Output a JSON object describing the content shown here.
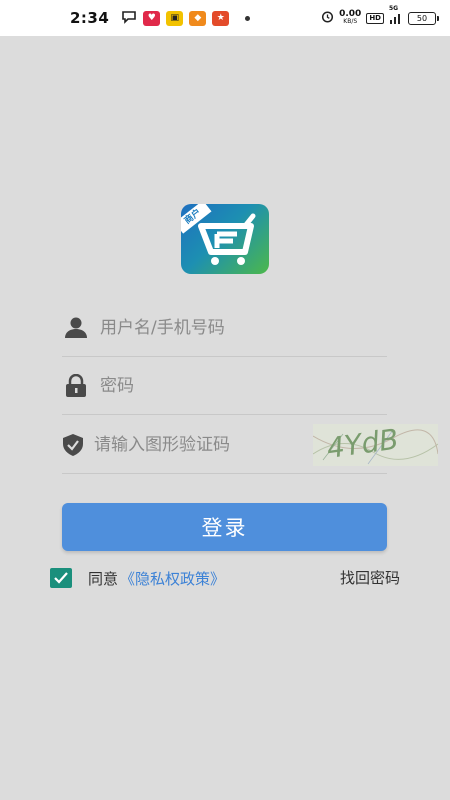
{
  "status_bar": {
    "time": "2:34",
    "net_speed_value": "0.00",
    "net_speed_unit": "KB/S",
    "hd_label": "HD",
    "signal_label": "5G",
    "battery_level": "50"
  },
  "logo": {
    "tag_text": "商户"
  },
  "form": {
    "username_placeholder": "用户名/手机号码",
    "password_placeholder": "密码",
    "captcha_placeholder": "请输入图形验证码",
    "captcha_text": "4YdB"
  },
  "login_button": {
    "label": "登录"
  },
  "agreement": {
    "checked": true,
    "prefix": "同意",
    "policy_link": "《隐私权政策》"
  },
  "forgot_password": {
    "label": "找回密码"
  },
  "colors": {
    "primary": "#4f8fdc",
    "checkbox": "#1a8f7c",
    "link": "#3d82d6",
    "background": "#dcdcdc"
  }
}
